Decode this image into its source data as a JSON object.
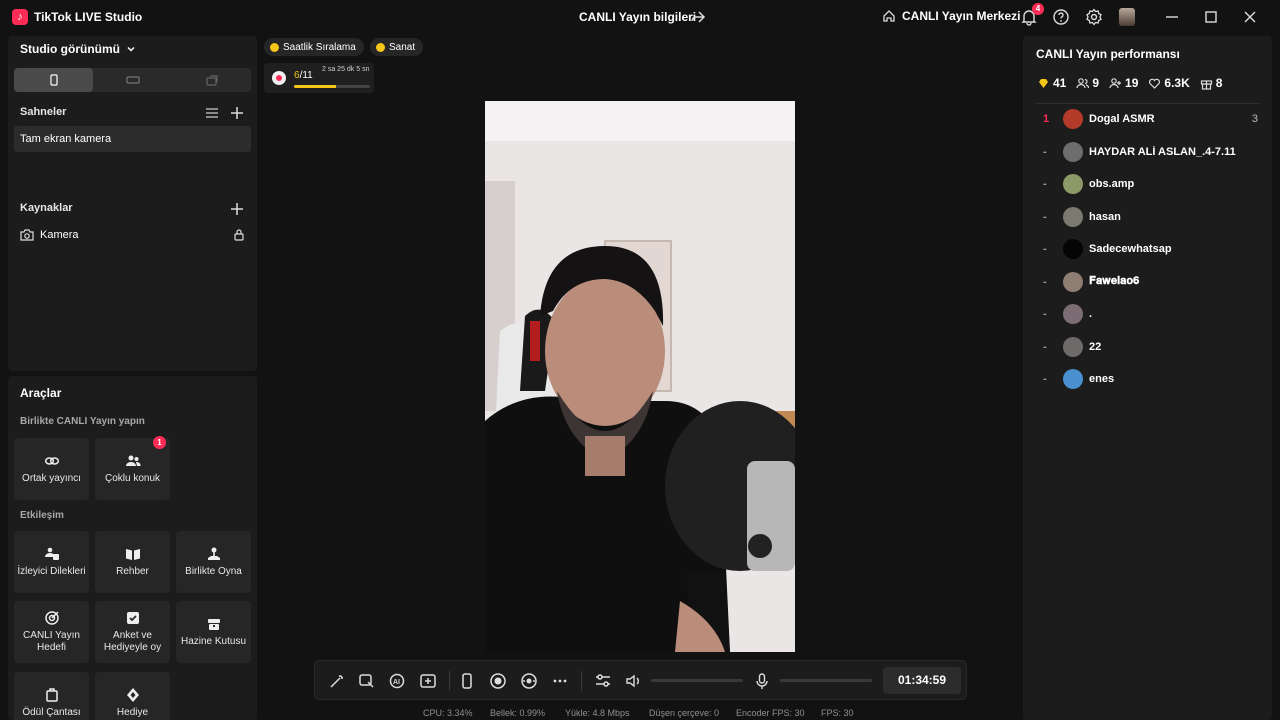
{
  "titlebar": {
    "app_title": "TikTok LIVE Studio",
    "center_title": "CANLI Yayın bilgileri",
    "live_center": "CANLI Yayın Merkezi",
    "notification_count": "4"
  },
  "left": {
    "studio_view_label": "Studio görünümü",
    "scenes_title": "Sahneler",
    "scene_item": "Tam ekran kamera",
    "sources_title": "Kaynaklar",
    "source_item": "Kamera"
  },
  "tools": {
    "title": "Araçlar",
    "collab_title": "Birlikte CANLI Yayın yapın",
    "collab": [
      {
        "label": "Ortak yayıncı"
      },
      {
        "label": "Çoklu konuk",
        "badge": "1"
      }
    ],
    "engage_title": "Etkileşim",
    "engage": [
      {
        "label": "İzleyici Dilekleri"
      },
      {
        "label": "Rehber"
      },
      {
        "label": "Birlikte Oyna"
      },
      {
        "label": "CANLI Yayın Hedefi"
      },
      {
        "label": "Anket ve Hediyeyle oy"
      },
      {
        "label": "Hazine Kutusu"
      },
      {
        "label": "Ödül Çantası"
      },
      {
        "label": "Hediye"
      }
    ]
  },
  "top_pills": {
    "hourly_rank": "Saatlik Sıralama",
    "category": "Sanat"
  },
  "rank_box": {
    "current": "6",
    "total": "/11",
    "time_left": "2 sa 25 dk 5 sn",
    "progress": 0.55
  },
  "bottom_bar": {
    "timer": "01:34:59",
    "volume_level": 0.0,
    "mic_level": 0.0
  },
  "stats": {
    "cpu": "CPU: 3.34%",
    "memory": "Bellek: 0.99%",
    "upload": "Yükle: 4.8 Mbps",
    "dropped": "Düşen çerçeve: 0",
    "encoder_fps": "Encoder FPS: 30",
    "fps": "FPS: 30"
  },
  "performance": {
    "title": "CANLI Yayın performansı",
    "diamonds": "41",
    "viewers": "9",
    "new_followers": "19",
    "likes": "6.3K",
    "gifts": "8",
    "top_viewers": [
      {
        "rank": "1",
        "name": "Dogal ASMR",
        "score": "3",
        "color": "#b43a2a"
      },
      {
        "rank": "-",
        "name": "HAYDAR ALİ ASLAN_.4-7.11",
        "score": "",
        "color": "#6d6d6d"
      },
      {
        "rank": "-",
        "name": "obs.amp",
        "score": "",
        "color": "#8c9a6a"
      },
      {
        "rank": "-",
        "name": "hasan",
        "score": "",
        "color": "#7a7a6e"
      },
      {
        "rank": "-",
        "name": "Sadecewhatsap",
        "score": "",
        "color": "#050505"
      },
      {
        "rank": "-",
        "name": "𝐅𝐚𝐰𝐞𝐥𝐚𝐨𝟔",
        "score": "",
        "color": "#8e7d72"
      },
      {
        "rank": "-",
        "name": ".",
        "score": "",
        "color": "#7c6d74"
      },
      {
        "rank": "-",
        "name": "22",
        "score": "",
        "color": "#6e6a6a"
      },
      {
        "rank": "-",
        "name": "enes",
        "score": "",
        "color": "#4a8fd0"
      }
    ]
  },
  "colors": {
    "accent": "#fe2c55",
    "gold": "#f5c518",
    "panel": "#1c1c1c",
    "background": "#121212"
  }
}
